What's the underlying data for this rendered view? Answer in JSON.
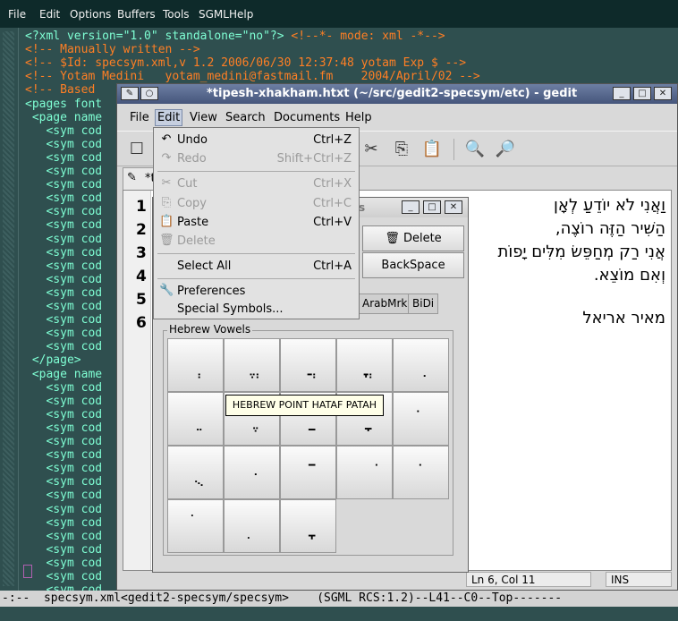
{
  "emacs": {
    "menu": [
      "File",
      "Edit",
      "Options",
      "Buffers",
      "Tools",
      "SGML",
      "Help"
    ],
    "lines": [
      {
        "t": "<?xml version=\"1.0\" standalone=\"no\"?> ",
        "c": "<!--*- mode: xml -*-->"
      },
      {
        "t": "",
        "c": "<!-- Manually written -->"
      },
      {
        "t": "",
        "c": "<!-- $Id: specsym.xml,v 1.2 2006/06/30 12:37:48 yotam Exp $ -->"
      },
      {
        "t": "",
        "c": "<!-- Yotam Medini   yotam_medini@fastmail.fm    2004/April/02 -->"
      },
      {
        "t": "",
        "c": "<!-- Based"
      },
      {
        "t": "<pages font",
        "c": ""
      },
      {
        "t": " <page name",
        "c": ""
      },
      {
        "t": "   <sym cod",
        "c": ""
      },
      {
        "t": "   <sym cod",
        "c": ""
      },
      {
        "t": "   <sym cod",
        "c": ""
      },
      {
        "t": "   <sym cod",
        "c": ""
      },
      {
        "t": "   <sym cod",
        "c": ""
      },
      {
        "t": "   <sym cod",
        "c": ""
      },
      {
        "t": "   <sym cod",
        "c": ""
      },
      {
        "t": "   <sym cod",
        "c": ""
      },
      {
        "t": "   <sym cod",
        "c": ""
      },
      {
        "t": "   <sym cod",
        "c": ""
      },
      {
        "t": "   <sym cod",
        "c": ""
      },
      {
        "t": "   <sym cod",
        "c": ""
      },
      {
        "t": "   <sym cod",
        "c": ""
      },
      {
        "t": "   <sym cod",
        "c": ""
      },
      {
        "t": "   <sym cod",
        "c": ""
      },
      {
        "t": "   <sym cod",
        "c": ""
      },
      {
        "t": "   <sym cod",
        "c": ""
      },
      {
        "t": " </page>",
        "c": ""
      },
      {
        "t": " <page name",
        "c": ""
      },
      {
        "t": "   <sym cod",
        "c": ""
      },
      {
        "t": "   <sym cod",
        "c": ""
      },
      {
        "t": "   <sym cod",
        "c": ""
      },
      {
        "t": "   <sym cod",
        "c": ""
      },
      {
        "t": "   <sym cod",
        "c": ""
      },
      {
        "t": "   <sym cod",
        "c": ""
      },
      {
        "t": "   <sym cod",
        "c": ""
      },
      {
        "t": "   <sym cod",
        "c": ""
      },
      {
        "t": "   <sym cod",
        "c": ""
      },
      {
        "t": "   <sym cod",
        "c": ""
      },
      {
        "t": "   <sym cod",
        "c": ""
      },
      {
        "t": "   <sym cod",
        "c": ""
      },
      {
        "t": "   <sym cod",
        "c": ""
      },
      {
        "t": "   <sym cod",
        "c": ""
      },
      {
        "t": "   <sym cod",
        "c": ""
      },
      {
        "t": "   <sym cod",
        "c": ""
      }
    ],
    "modeline": "-:--  specsym.xml<gedit2-specsym/specsym>    (SGML RCS:1.2)--L41--C0--Top-------"
  },
  "gedit": {
    "title": "*tipesh-xhakham.htxt (~/src/gedit2-specsym/etc) - gedit",
    "menu": [
      "File",
      "Edit",
      "View",
      "Search",
      "Documents",
      "Help"
    ],
    "tab_label": "*t",
    "line_numbers": [
      "1",
      "2",
      "3",
      "4",
      "5",
      "6"
    ],
    "doc_lines": [
      "וַאֲנִי לֹא יוֹדֵעַ לְאָן",
      "הַשִּׁיר הַזֶּה רוֹצֶה,",
      "אֲנִי רַק מְחַפֵּשׂ מִלִּים יָפוֹת",
      "וְאִם מוֹצֵא.",
      "",
      "מאיר אריאל"
    ],
    "status_pos": "Ln 6, Col 11",
    "status_mode": "INS"
  },
  "edit_menu": {
    "items": [
      {
        "icon": "↶",
        "label": "Undo",
        "shortcut": "Ctrl+Z",
        "enabled": true
      },
      {
        "icon": "↷",
        "label": "Redo",
        "shortcut": "Shift+Ctrl+Z",
        "enabled": false
      },
      {
        "icon": "✂",
        "label": "Cut",
        "shortcut": "Ctrl+X",
        "enabled": false
      },
      {
        "icon": "⎘",
        "label": "Copy",
        "shortcut": "Ctrl+C",
        "enabled": false
      },
      {
        "icon": "📋",
        "label": "Paste",
        "shortcut": "Ctrl+V",
        "enabled": true
      },
      {
        "icon": "🗑",
        "label": "Delete",
        "shortcut": "",
        "enabled": false
      },
      {
        "icon": "",
        "label": "Select All",
        "shortcut": "Ctrl+A",
        "enabled": true
      },
      {
        "icon": "🔧",
        "label": "Preferences",
        "shortcut": "",
        "enabled": true
      },
      {
        "icon": "",
        "label": "Special Symbols...",
        "shortcut": "",
        "enabled": true
      }
    ]
  },
  "symbols": {
    "title": "s",
    "delete_label": "Delete",
    "backspace_label": "BackSpace",
    "tabs": [
      "ArabMrk",
      "BiDi"
    ],
    "group_label": "Hebrew Vowels",
    "tooltip": "HEBREW POINT HATAF PATAH",
    "buttons": [
      "ְ",
      "ֱ",
      "ֲ",
      "ֳ",
      "ִ",
      "ֵ",
      "ֶ",
      "ַ",
      "ָ",
      "ֹ",
      "ֻ",
      "ּ",
      "ֿ",
      "ׁ",
      "ׂ",
      "ׄ",
      "ׅ",
      "ׇ"
    ]
  }
}
